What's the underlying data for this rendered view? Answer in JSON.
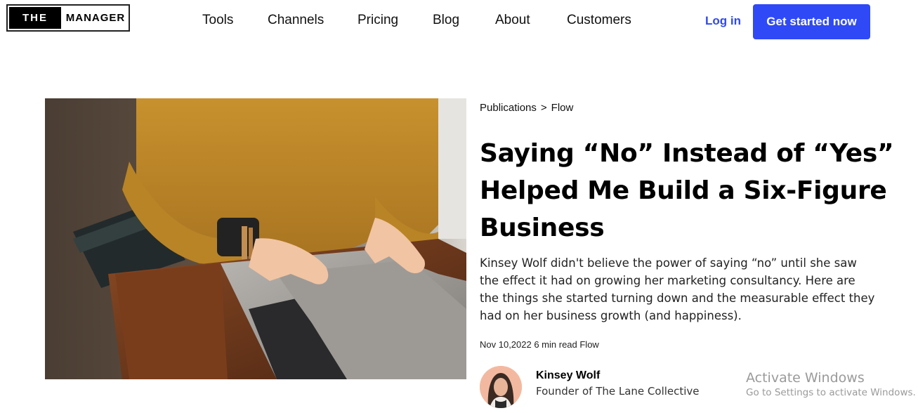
{
  "brand": {
    "logo_the": "THE",
    "logo_manager": "MANAGER"
  },
  "nav": {
    "items": [
      {
        "label": "Tools"
      },
      {
        "label": "Channels"
      },
      {
        "label": "Pricing"
      },
      {
        "label": "Blog"
      },
      {
        "label": "About"
      },
      {
        "label": "Customers"
      }
    ],
    "login": "Log in",
    "cta": "Get started now"
  },
  "colors": {
    "accent": "#2f49f6"
  },
  "article": {
    "breadcrumb": {
      "parent": "Publications",
      "separator": ">",
      "current": "Flow"
    },
    "title_lines": [
      "Saying “No” Instead of “Yes”",
      "Helped Me Build a Six-Figure",
      "Business"
    ],
    "description": "Kinsey Wolf didn't believe the power of saying “no” until she saw the effect it had on growing her marketing consultancy. Here are the things she started turning down and the measurable effect they had on her business growth (and happiness).",
    "meta": "Nov 10,2022 6 min read Flow",
    "hero_image": "woman-typing-on-laptop-photo",
    "author": {
      "name": "Kinsey Wolf",
      "role": "Founder of The Lane Collective",
      "avatar": "author-portrait-photo"
    }
  },
  "watermark": {
    "title": "Activate Windows",
    "subtitle": "Go to Settings to activate Windows."
  }
}
